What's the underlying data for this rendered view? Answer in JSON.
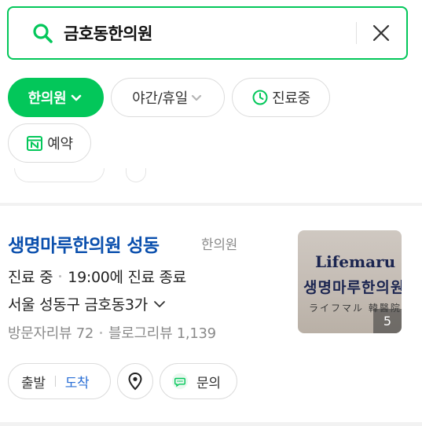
{
  "search": {
    "query": "금호동한의원",
    "icons": {
      "search": "search-icon",
      "clear": "close-icon"
    }
  },
  "filters": {
    "chips": [
      {
        "label": "한의원",
        "active": true,
        "icon": "chevron-down-icon"
      },
      {
        "label": "야간/휴일",
        "active": false,
        "icon": "chevron-down-icon"
      },
      {
        "label": "진료중",
        "active": false,
        "icon": "clock-icon"
      },
      {
        "label": "예약",
        "active": false,
        "icon": "naver-booking-icon"
      }
    ]
  },
  "result": {
    "name": "생명마루한의원 성동",
    "category": "한의원",
    "status": "진료 중",
    "closing": "19:00에 진료 종료",
    "address": "서울 성동구 금호동3가",
    "visitor_reviews": "방문자리뷰 72",
    "blog_reviews": "블로그리뷰 1,139",
    "image": {
      "logo_en": "Lifemaru",
      "logo_ko": "생명마루한의원",
      "logo_sub": "ライフマル 韓醫院",
      "photo_count": "5"
    },
    "actions": {
      "depart": "출발",
      "arrive": "도착",
      "inquiry": "문의"
    }
  },
  "colors": {
    "brand_green": "#03c75a",
    "title_blue": "#0a4fad",
    "arrive_blue": "#2a6fd6",
    "muted": "#8a8a8a"
  }
}
